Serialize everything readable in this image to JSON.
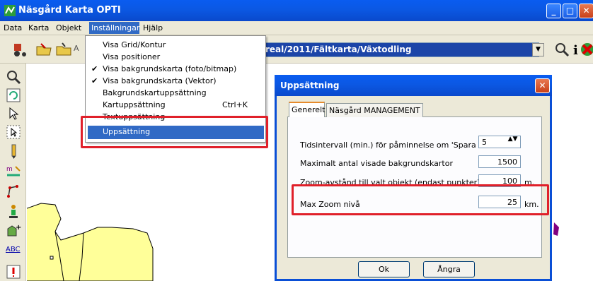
{
  "window": {
    "title": "Näsgård Karta OPTI",
    "btn_min": "_",
    "btn_max": "□",
    "btn_close": "✕"
  },
  "menubar": {
    "items": [
      "Data",
      "Karta",
      "Objekt",
      "Inställningar",
      "Hjälp"
    ]
  },
  "toolbar": {
    "path": "real/2011/Fältkarta/Växtodling",
    "combo_arrow": "▼",
    "left_label_fragment": "A"
  },
  "dropdown": {
    "items": [
      {
        "label": "Visa Grid/Kontur",
        "checked": false
      },
      {
        "label": "Visa positioner",
        "checked": false
      },
      {
        "label": "Visa bakgrundskarta (foto/bitmap)",
        "checked": true
      },
      {
        "label": "Visa bakgrundskarta (Vektor)",
        "checked": true
      },
      {
        "label": "Bakgrundskartuppsättning",
        "checked": false
      },
      {
        "label": "Kartuppsättning",
        "checked": false,
        "shortcut": "Ctrl+K"
      },
      {
        "label": "Textuppsättning",
        "checked": false
      },
      {
        "label": "Uppsättning",
        "checked": false,
        "highlighted": true
      }
    ],
    "check_glyph": "✔"
  },
  "dialog": {
    "title": "Uppsättning",
    "close": "✕",
    "tabs": [
      "Generelt",
      "Näsgård MANAGEMENT"
    ],
    "fields": [
      {
        "label": "Tidsintervall (min.) för påminnelse om 'Spara data'",
        "value": "5",
        "unit": ""
      },
      {
        "label": "Maximalt antal visade bakgrundskartor",
        "value": "1500",
        "unit": ""
      },
      {
        "label": "Zoom-avstånd till valt objekt (endast punkter)",
        "value": "100",
        "unit": "m."
      },
      {
        "label": "Max Zoom nivå",
        "value": "25",
        "unit": "km."
      }
    ],
    "stepper": "▲▼",
    "buttons": {
      "ok": "Ok",
      "cancel": "Ångra"
    }
  },
  "left_tools": {
    "abc_label": "ABC"
  },
  "colors": {
    "highlight": "#316ac5",
    "red_box": "#e0202a",
    "titlebar": "#0a5cf0",
    "parcel": "#ffff99"
  }
}
